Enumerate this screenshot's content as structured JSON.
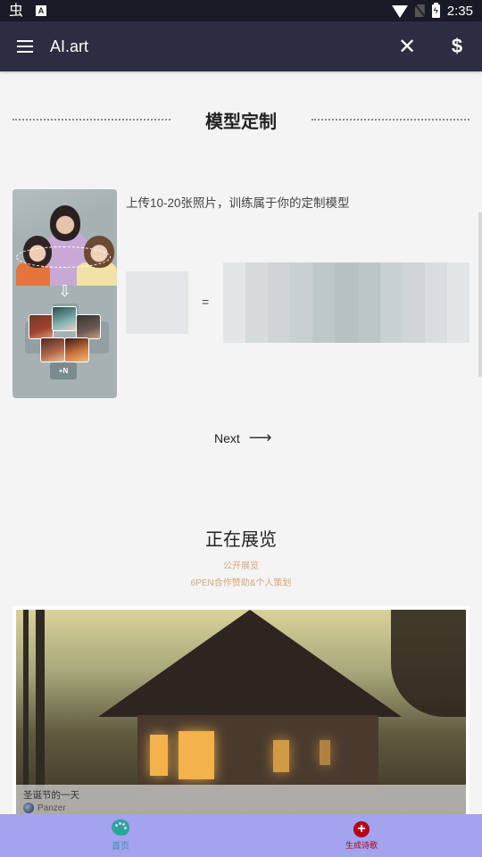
{
  "status_bar": {
    "left_icons": [
      "bug-icon",
      "a-notification-icon"
    ],
    "right_icons": [
      "wifi-icon",
      "no-sim-icon",
      "battery-charging-icon"
    ],
    "time": "2:35",
    "bug_glyph": "虫",
    "a_glyph": "A"
  },
  "app_bar": {
    "title": "AI.art",
    "menu_icon": "hamburger-menu-icon",
    "close_icon": "close-icon",
    "close_glyph": "✕",
    "dollar_icon": "dollar-icon",
    "dollar_glyph": "$"
  },
  "model_section": {
    "heading": "模型定制",
    "description": "上传10-20张照片，训练属于你的定制模型",
    "illustration_badge": "+N",
    "down_arrow_glyph": "⇩",
    "equals": "=",
    "strip_colors": [
      "#e3e6e7",
      "#d6dbdc",
      "#cfd5d6",
      "#c8d0d1",
      "#bfc8c9",
      "#b8c1c2",
      "#bdc6c7",
      "#c9d1d2",
      "#d0d6d7",
      "#d9dddf",
      "#e3e6e7"
    ],
    "next_label": "Next",
    "next_arrow": "⟶"
  },
  "exhibition": {
    "title": "正在展览",
    "subtitle_1": "公开展览",
    "subtitle_2": "6PEN合作赞助&个人策划",
    "accent_color": "#d6a77b",
    "cards": [
      {
        "title": "圣诞节的一天",
        "author": "Panzer"
      }
    ]
  },
  "bottom_nav": {
    "background": "#a3a3ee",
    "items": [
      {
        "label": "首页",
        "icon": "palette-icon",
        "color": "#3a8fb0"
      },
      {
        "label": "生成诗歌",
        "icon": "add-circle-icon",
        "glyph": "+",
        "color": "#b3001b"
      }
    ]
  }
}
